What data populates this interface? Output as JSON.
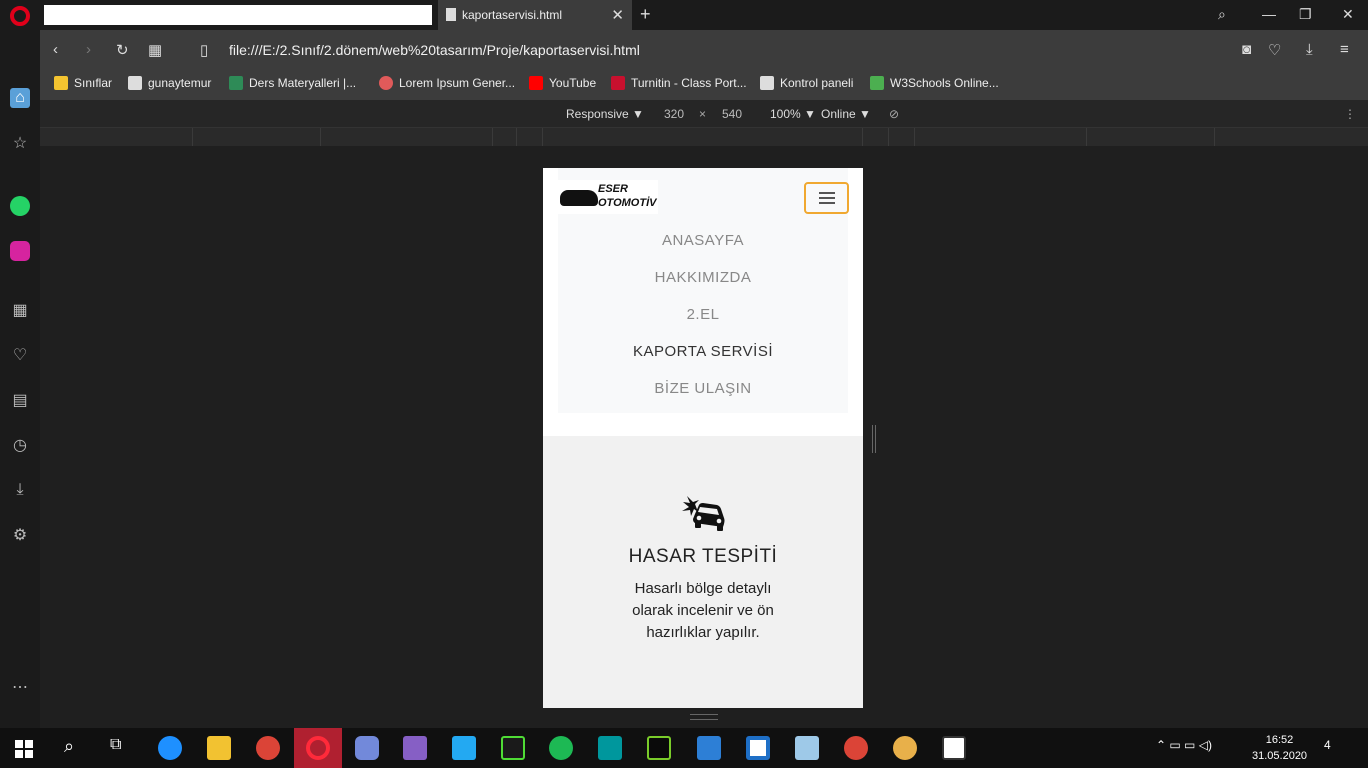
{
  "browser": {
    "tab_title": "kaportaservisi.html",
    "tab_close": "✕",
    "new_tab": "+",
    "url": "file:///E:/2.Sınıf/2.dönem/web%20tasarım/Proje/kaportaservisi.html"
  },
  "bookmarks": [
    {
      "label": "Sınıflar",
      "color": "#f4c430"
    },
    {
      "label": "gunaytemur",
      "color": "#dddddd"
    },
    {
      "label": "Ders Materyalleri |...",
      "color": "#2e8b57"
    },
    {
      "label": "Lorem Ipsum Gener...",
      "color": "#e05a5a"
    },
    {
      "label": "YouTube",
      "color": "#ff0000"
    },
    {
      "label": "Turnitin - Class Port...",
      "color": "#c8102e"
    },
    {
      "label": "Kontrol paneli",
      "color": "#dddddd"
    },
    {
      "label": "W3Schools Online...",
      "color": "#4caf50"
    }
  ],
  "device_toolbar": {
    "mode": "Responsive ▼",
    "width": "320",
    "times": "×",
    "height": "540",
    "zoom": "100% ▼",
    "network": "Online ▼"
  },
  "site": {
    "logo_line1": "ESER",
    "logo_line2": "OTOMOTİV",
    "menu": [
      "ANASAYFA",
      "HAKKIMIZDA",
      "2.EL",
      "KAPORTA SERVİSİ",
      "BİZE ULAŞIN"
    ],
    "active_menu": "KAPORTA SERVİSİ",
    "service_title": "HASAR TESPİTİ",
    "service_desc": "Hasarlı bölge detaylı olarak incelenir ve ön hazırlıklar yapılır."
  },
  "taskbar": {
    "time": "16:52",
    "date": "31.05.2020",
    "notifications": "4"
  },
  "colors": {
    "accent_toggler": "#f0a830",
    "opera_red": "#e0001a"
  }
}
